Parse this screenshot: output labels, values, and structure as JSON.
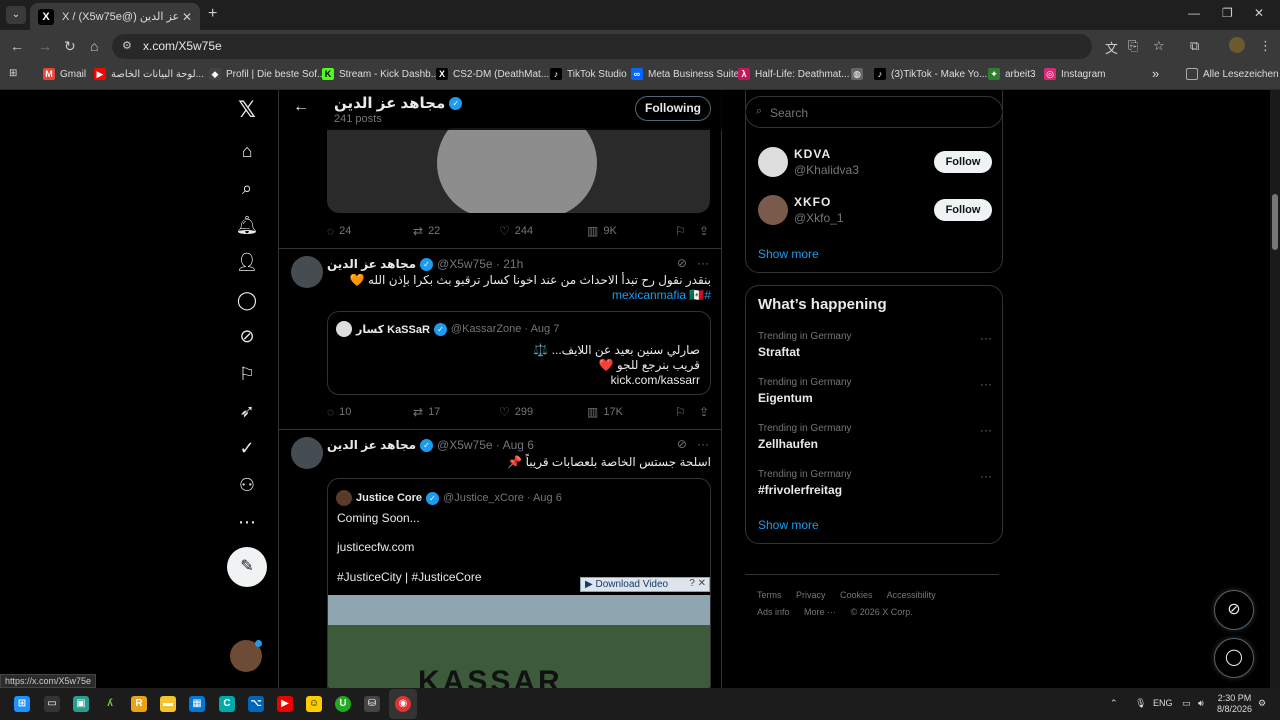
{
  "browser": {
    "tab_title": "X / (X5w75e@) مجاهد عز الدين",
    "tab_close": "✕",
    "new_tab": "+",
    "url": "x.com/X5w75e",
    "window_controls": [
      "—",
      "❐",
      "✕"
    ]
  },
  "bookmarks": [
    {
      "label": "Gmail",
      "icon": "gmail-icon",
      "color": "#ea4335",
      "glyph": "M"
    },
    {
      "label": "لوحة البيانات الخاصة...",
      "icon": "youtube-icon",
      "color": "#ff0000",
      "glyph": "▶"
    },
    {
      "label": "Profil | Die beste Sof...",
      "icon": "profil-icon",
      "color": "#444444",
      "glyph": "◆"
    },
    {
      "label": "Stream - Kick Dashb...",
      "icon": "kick-icon",
      "color": "#53fc18",
      "glyph": "K"
    },
    {
      "label": "CS2-DM (DeathMat...",
      "icon": "x-icon",
      "color": "#000000",
      "glyph": "𝕏"
    },
    {
      "label": "TikTok Studio",
      "icon": "tiktok-icon",
      "color": "#000000",
      "glyph": "♪"
    },
    {
      "label": "Meta Business Suite",
      "icon": "meta-icon",
      "color": "#0866ff",
      "glyph": "∞"
    },
    {
      "label": "Half-Life: Deathmat...",
      "icon": "halflife-icon",
      "color": "#c2185b",
      "glyph": "λ"
    },
    {
      "label": "",
      "icon": "globe-icon",
      "color": "#666666",
      "glyph": "◍"
    },
    {
      "label": "(3)TikTok - Make Yo...",
      "icon": "tiktok-icon",
      "color": "#000000",
      "glyph": "♪"
    },
    {
      "label": "arbeit3",
      "icon": "arbeit-icon",
      "color": "#2e7d32",
      "glyph": "✦"
    },
    {
      "label": "Instagram",
      "icon": "instagram-icon",
      "color": "#d62976",
      "glyph": "◎"
    }
  ],
  "bookmarks_more": "»",
  "all_bookmarks": "Alle Lesezeichen",
  "profile_header": {
    "name": "مجاهد عز الدين",
    "posts": "241 posts",
    "following_button": "Following"
  },
  "tweet0_actions": {
    "replies": "24",
    "reposts": "22",
    "likes": "244",
    "views": "9K"
  },
  "tweet1": {
    "name": "مجاهد عز الدين",
    "handle": "@X5w75e · 21h",
    "text": "بنقدر نقول رح تبدأ الاحداث من عند اخونا كسار ترقبو بث بكرا بإذن الله 🧡",
    "hashtag": "#mexicanmafia 🇲🇽",
    "quote": {
      "name": "كسار KaSSaR",
      "handle": "@KassarZone · Aug 7",
      "line1": "صارلي سنين بعيد عن اللايف... ⚖️",
      "line2": "قريب بنرجع للجو ❤️",
      "line3": "kick.com/kassarr"
    },
    "actions": {
      "replies": "10",
      "reposts": "17",
      "likes": "299",
      "views": "17K"
    }
  },
  "tweet2": {
    "name": "مجاهد عز الدين",
    "handle": "@X5w75e · Aug 6",
    "text": "اسلحة جستس الخاصة بلعصابات قريباً 📌",
    "quote": {
      "name": "Justice Core",
      "handle": "@Justice_xCore · Aug 6",
      "line1": "Coming Soon...",
      "line2": "justicecfw.com",
      "line3": "#JusticeCity | #JusticeCore",
      "video_text": "KASSAR"
    },
    "download_bar": "▶ Download Video"
  },
  "search": {
    "placeholder": "Search"
  },
  "who_to_follow": [
    {
      "name": "KDVA",
      "handle": "@Khalidva3",
      "button": "Follow"
    },
    {
      "name": "XKFO",
      "handle": "@Xkfo_1",
      "button": "Follow"
    }
  ],
  "show_more": "Show more",
  "whats_happening": {
    "title": "What’s happening",
    "trends": [
      {
        "context": "Trending in Germany",
        "topic": "Straftat"
      },
      {
        "context": "Trending in Germany",
        "topic": "Eigentum"
      },
      {
        "context": "Trending in Germany",
        "topic": "Zellhaufen"
      },
      {
        "context": "Trending in Germany",
        "topic": "#frivolerfreitag"
      }
    ],
    "show_more": "Show more"
  },
  "footer": {
    "row1": [
      "Terms",
      "Privacy",
      "Cookies",
      "Accessibility"
    ],
    "row2": [
      "Ads info",
      "More ···",
      "© 2026 X Corp."
    ]
  },
  "status_url": "https://x.com/X5w75e",
  "taskbar": {
    "lang": "ENG",
    "time": "2:30 PM",
    "date": "8/8/2026"
  },
  "colors": {
    "accent": "#1d9bf0",
    "background": "#000000",
    "text": "#e7e9ea",
    "muted": "#71767b"
  }
}
